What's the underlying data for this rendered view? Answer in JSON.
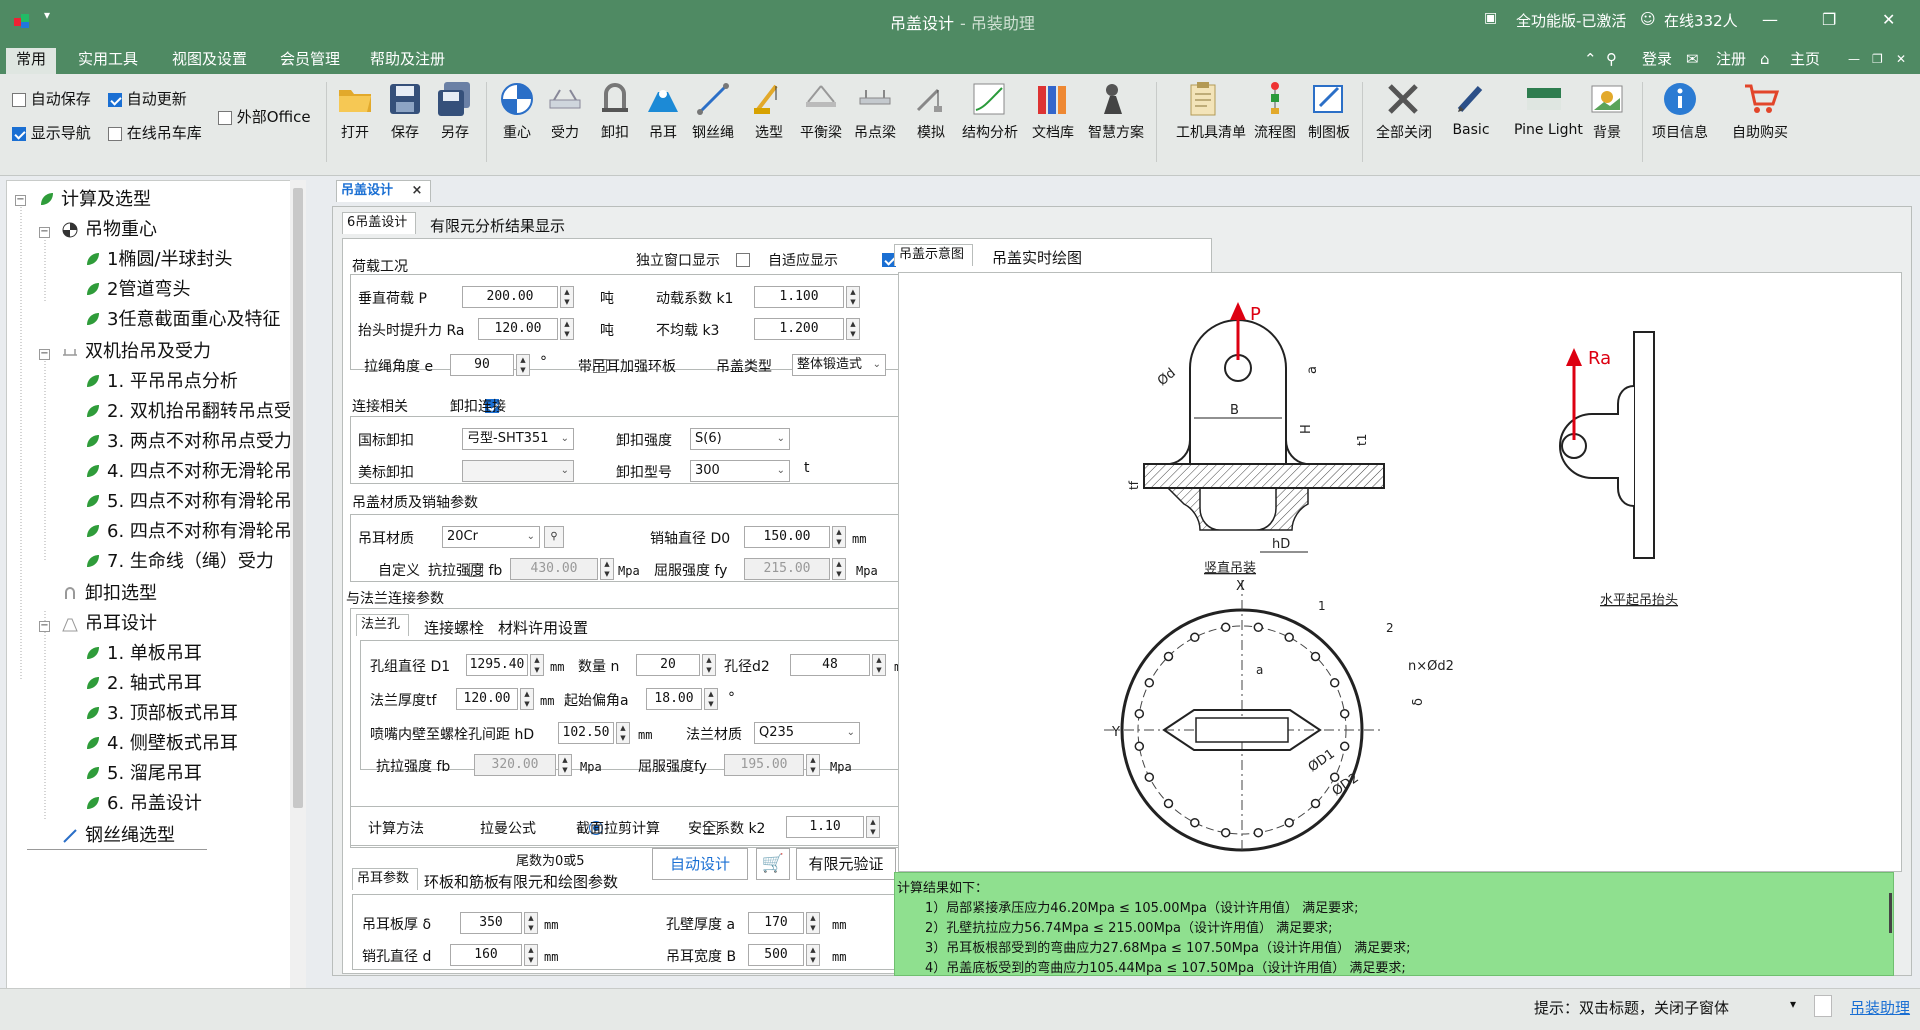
{
  "window": {
    "title": "吊盖设计",
    "subtitle": " - 吊装助理",
    "license": "全功能版-已激活",
    "online": "在线332人",
    "minimize": "—",
    "restore": "❐",
    "close": "✕"
  },
  "menu": {
    "items": [
      "常用",
      "实用工具",
      "视图及设置",
      "会员管理",
      "帮助及注册"
    ],
    "right": [
      "登录",
      "注册",
      "主页"
    ]
  },
  "quick": {
    "autosave": "自动保存",
    "autoupdate": "自动更新",
    "external_office": "外部Office",
    "show_nav": "显示导航",
    "online_crane": "在线吊车库"
  },
  "tools": [
    "打开",
    "保存",
    "另存",
    "重心",
    "受力",
    "卸扣",
    "吊耳",
    "钢丝绳",
    "选型",
    "平衡梁",
    "吊点梁",
    "模拟",
    "结构分析",
    "文档库",
    "智慧方案",
    "工机具清单",
    "流程图",
    "制图板",
    "全部关闭",
    "Basic",
    "Pine Light",
    "背景",
    "项目信息",
    "自助购买"
  ],
  "tree": {
    "root": "计算及选型",
    "g1": "吊物重心",
    "g1_items": [
      "1椭圆/半球封头",
      "2管道弯头",
      "3任意截面重心及特征"
    ],
    "g2": "双机抬吊及受力",
    "g2_items": [
      "1. 平吊吊点分析",
      "2. 双机抬吊翻转吊点受力",
      "3. 两点不对称吊点受力",
      "4. 四点不对称无滑轮吊点",
      "5. 四点不对称有滑轮吊点",
      "6. 四点不对称有滑轮吊点",
      "7. 生命线（绳）受力"
    ],
    "g3": "卸扣选型",
    "g4": "吊耳设计",
    "g4_items": [
      "1. 单板吊耳",
      "2. 轴式吊耳",
      "3. 顶部板式吊耳",
      "4. 侧壁板式吊耳",
      "5. 溜尾吊耳",
      "6. 吊盖设计"
    ],
    "g5": "钢丝绳选型"
  },
  "doc_tab": {
    "label": "吊盖设计",
    "close": "×"
  },
  "inner_tabs": [
    "6吊盖设计",
    "有限元分析结果显示"
  ],
  "load": {
    "title": "荷载工况",
    "indep_window": "独立窗口显示",
    "adaptive": "自适应显示",
    "vload_label": "垂直荷载 P",
    "vload": "200.00",
    "vload_unit": "吨",
    "dyn_label": "动载系数 k1",
    "dyn": "1.100",
    "lift_label": "抬头时提升力 Ra",
    "lift": "120.00",
    "lift_unit": "吨",
    "uneven_label": "不均载 k3",
    "uneven": "1.200",
    "angle_label": "拉绳角度 e",
    "angle": "90",
    "angle_unit": "°",
    "ring_label": "带吊耳加强环板",
    "type_label": "吊盖类型",
    "type": "整体锻造式"
  },
  "conn": {
    "title": "连接相关",
    "shackle": "卸扣连接",
    "gb_label": "国标卸扣",
    "gb_value": "弓型-SHT351",
    "strength_label": "卸扣强度",
    "strength": "S(6)",
    "us_label": "美标卸扣",
    "model_label": "卸扣型号",
    "model": "300",
    "model_unit": "t"
  },
  "mat": {
    "title": "吊盖材质及销轴参数",
    "lug_label": "吊耳材质",
    "lug": "20Cr",
    "pin_label": "销轴直径 D0",
    "pin": "150.00",
    "pin_unit": "mm",
    "custom": "自定义",
    "tensile_label": "抗拉强度 fb",
    "tensile": "430.00",
    "tensile_unit": "Mpa",
    "yield_label": "屈服强度 fy",
    "yield": "215.00",
    "yield_unit": "Mpa"
  },
  "flange": {
    "title": "与法兰连接参数",
    "tabs": [
      "法兰孔",
      "连接螺栓",
      "材料许用设置"
    ],
    "d1_label": "孔组直径 D1",
    "d1": "1295.40",
    "d1_unit": "mm",
    "n_label": "数量 n",
    "n": "20",
    "d2_label": "孔径d2",
    "d2": "48",
    "d2_unit": "mm",
    "tf_label": "法兰厚度tf",
    "tf": "120.00",
    "tf_unit": "mm",
    "a_label": "起始偏角a",
    "a": "18.00",
    "a_unit": "°",
    "hd_label": "喷嘴内壁至螺栓孔间距 hD",
    "hd": "102.50",
    "hd_unit": "mm",
    "fmat_label": "法兰材质",
    "fmat": "Q235",
    "fb_label": "抗拉强度 fb",
    "fb": "320.00",
    "fb_unit": "Mpa",
    "fy_label": "屈服强度fy",
    "fy": "195.00",
    "fy_unit": "Mpa"
  },
  "method": {
    "label": "计算方法",
    "lame": "拉曼公式",
    "shear": "截面拉剪计算",
    "k2_label": "安全系数 k2",
    "k2": "1.10"
  },
  "bottom": {
    "tail05": "尾数为0或5",
    "tabs": [
      "吊耳参数",
      "环板和筋板",
      "有限元和绘图参数"
    ],
    "auto": "自动设计",
    "fem": "有限元验证",
    "thick_label": "吊耳板厚 δ",
    "thick": "350",
    "thick_unit": "mm",
    "wall_label": "孔壁厚度 a",
    "wall": "170",
    "wall_unit": "mm",
    "hole_label": "销孔直径 d",
    "hole": "160",
    "hole_unit": "mm",
    "width_label": "吊耳宽度 B",
    "width": "500",
    "width_unit": "mm"
  },
  "figure": {
    "tabs": [
      "吊盖示意图",
      "吊盖实时绘图"
    ],
    "P": "P",
    "Ra": "Ra",
    "od": "Ød",
    "a": "a",
    "B": "B",
    "H": "H",
    "t1": "t1",
    "tf": "tf",
    "hD": "hD",
    "vertical": "竖直吊装",
    "horizontal": "水平起吊抬头",
    "X": "X",
    "Y": "Y",
    "one": "1",
    "two": "2",
    "nd2": "n×Ød2",
    "delta": "δ",
    "D1": "ØD1",
    "D2": "ØD2",
    "alpha": "a"
  },
  "results": {
    "title": "计算结果如下：",
    "lines": [
      "1）局部紧接承压应力46.20Mpa ≤ 105.00Mpa（设计许用值） 满足要求;",
      "2）孔壁抗拉应力56.74Mpa ≤ 215.00Mpa（设计许用值） 满足要求;",
      "3）吊耳板根部受到的弯曲应力27.68Mpa ≤ 107.50Mpa（设计许用值） 满足要求;",
      "4）吊盖底板受到的弯曲应力105.44Mpa ≤ 107.50Mpa（设计许用值） 满足要求;"
    ]
  },
  "status": {
    "hint": "提示：双击标题，关闭子窗体",
    "link": "吊装助理"
  }
}
